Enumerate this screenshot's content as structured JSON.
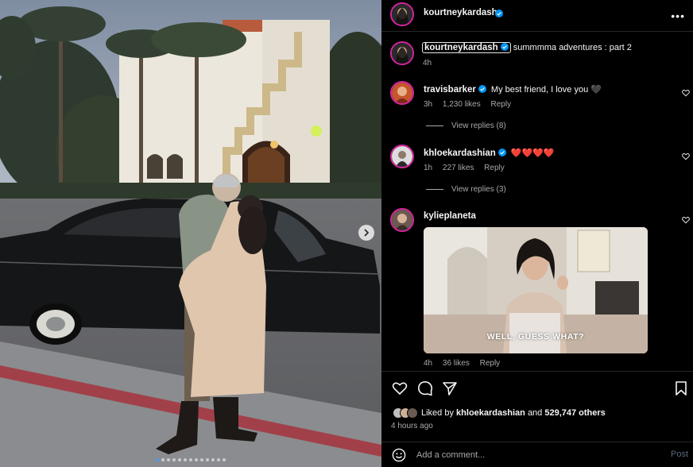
{
  "post": {
    "author": "kourtneykardash",
    "caption": "summmma adventures : part 2",
    "caption_time": "4h",
    "more_icon": "more-options-icon",
    "carousel": {
      "total_slides": 13,
      "active_slide": 1
    }
  },
  "comments": [
    {
      "username": "travisbarker",
      "verified": true,
      "text": "My best friend, I love you 🖤",
      "time": "3h",
      "likes": "1,230 likes",
      "reply": "Reply",
      "view_replies": "View replies (8)",
      "avatar_color": "#c7552e"
    },
    {
      "username": "khloekardashian",
      "verified": true,
      "text": "❤️❤️❤️❤️",
      "time": "1h",
      "likes": "227 likes",
      "reply": "Reply",
      "view_replies": "View replies (3)",
      "avatar_color": "#3d3d3d"
    },
    {
      "username": "kylieplaneta",
      "verified": false,
      "text": "",
      "gif_caption": "WELL, GUESS WHAT?",
      "time": "4h",
      "likes": "36 likes",
      "reply": "Reply",
      "avatar_color": "#6b5a50"
    }
  ],
  "engagement": {
    "liked_by_prefix": "Liked by",
    "liked_by_user": "khloekardashian",
    "liked_by_and": "and",
    "liked_by_count": "529,747 others",
    "time_ago": "4 hours ago"
  },
  "comment_box": {
    "placeholder": "Add a comment...",
    "post_label": "Post"
  },
  "colors": {
    "background": "#000000",
    "verified": "#0095f6",
    "story_ring": "#d6249f",
    "muted_text": "#a8a8a8",
    "post_button": "#5a6a7e"
  }
}
